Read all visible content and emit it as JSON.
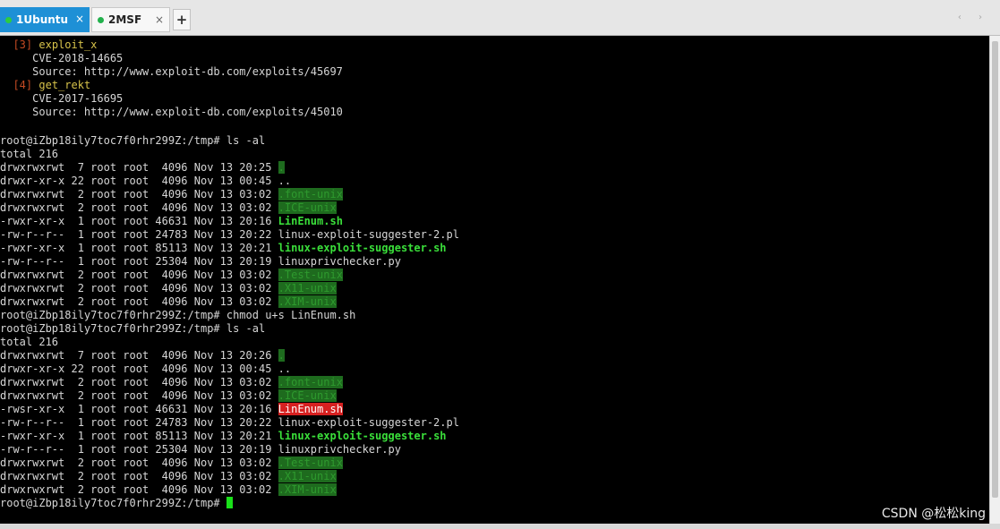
{
  "tabs": [
    {
      "num": "1",
      "label": " Ubuntu",
      "close": "×"
    },
    {
      "num": "2",
      "label": " MSF",
      "close": "×"
    }
  ],
  "new_tab_label": "+",
  "nav_arrows": "‹ ›",
  "terminal": {
    "l01_num": "[3]",
    "l01_name": " exploit_x",
    "l02": "     CVE-2018-14665",
    "l03": "     Source: http://www.exploit-db.com/exploits/45697",
    "l04_num": "[4]",
    "l04_name": " get_rekt",
    "l05": "     CVE-2017-16695",
    "l06": "     Source: http://www.exploit-db.com/exploits/45010",
    "l08": "root@iZbp18ily7toc7f0rhr299Z:/tmp# ls -al",
    "l09": "total 216",
    "l10_pre": "drwxrwxrwt  7 root root  4096 Nov 13 20:25 ",
    "l10_name": ".",
    "l11": "drwxr-xr-x 22 root root  4096 Nov 13 00:45 ..",
    "l12_pre": "drwxrwxrwt  2 root root  4096 Nov 13 03:02 ",
    "l12_name": ".font-unix",
    "l13_pre": "drwxrwxrwt  2 root root  4096 Nov 13 03:02 ",
    "l13_name": ".ICE-unix",
    "l14_pre": "-rwxr-xr-x  1 root root 46631 Nov 13 20:16 ",
    "l14_name": "LinEnum.sh",
    "l15": "-rw-r--r--  1 root root 24783 Nov 13 20:22 linux-exploit-suggester-2.pl",
    "l16_pre": "-rwxr-xr-x  1 root root 85113 Nov 13 20:21 ",
    "l16_name": "linux-exploit-suggester.sh",
    "l17": "-rw-r--r--  1 root root 25304 Nov 13 20:19 linuxprivchecker.py",
    "l18_pre": "drwxrwxrwt  2 root root  4096 Nov 13 03:02 ",
    "l18_name": ".Test-unix",
    "l19_pre": "drwxrwxrwt  2 root root  4096 Nov 13 03:02 ",
    "l19_name": ".X11-unix",
    "l20_pre": "drwxrwxrwt  2 root root  4096 Nov 13 03:02 ",
    "l20_name": ".XIM-unix",
    "l21": "root@iZbp18ily7toc7f0rhr299Z:/tmp# chmod u+s LinEnum.sh",
    "l22": "root@iZbp18ily7toc7f0rhr299Z:/tmp# ls -al",
    "l23": "total 216",
    "l24_pre": "drwxrwxrwt  7 root root  4096 Nov 13 20:26 ",
    "l24_name": ".",
    "l25": "drwxr-xr-x 22 root root  4096 Nov 13 00:45 ..",
    "l26_pre": "drwxrwxrwt  2 root root  4096 Nov 13 03:02 ",
    "l26_name": ".font-unix",
    "l27_pre": "drwxrwxrwt  2 root root  4096 Nov 13 03:02 ",
    "l27_name": ".ICE-unix",
    "l28_pre": "-rwsr-xr-x  1 root root 46631 Nov 13 20:16 ",
    "l28_name": "LinEnum.sh",
    "l29": "-rw-r--r--  1 root root 24783 Nov 13 20:22 linux-exploit-suggester-2.pl",
    "l30_pre": "-rwxr-xr-x  1 root root 85113 Nov 13 20:21 ",
    "l30_name": "linux-exploit-suggester.sh",
    "l31": "-rw-r--r--  1 root root 25304 Nov 13 20:19 linuxprivchecker.py",
    "l32_pre": "drwxrwxrwt  2 root root  4096 Nov 13 03:02 ",
    "l32_name": ".Test-unix",
    "l33_pre": "drwxrwxrwt  2 root root  4096 Nov 13 03:02 ",
    "l33_name": ".X11-unix",
    "l34_pre": "drwxrwxrwt  2 root root  4096 Nov 13 03:02 ",
    "l34_name": ".XIM-unix",
    "l35": "root@iZbp18ily7toc7f0rhr299Z:/tmp# "
  },
  "watermark": "CSDN @松松king",
  "colors": {
    "tab_active": "#1e90d6",
    "terminal_bg": "#000000",
    "terminal_fg": "#d6d6d6",
    "dir_highlight": "#1e6b1e",
    "executable": "#3adf3a",
    "suid_highlight": "#d62020",
    "cursor": "#19e019"
  }
}
